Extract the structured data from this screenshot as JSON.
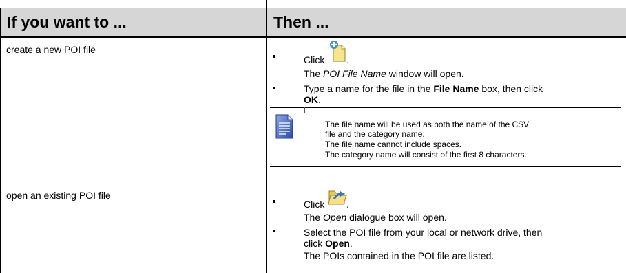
{
  "header": {
    "col1": "If you want to ...",
    "col2": "Then ..."
  },
  "rows": [
    {
      "action": "create a new POI file",
      "step1": {
        "click": "Click",
        "icon": "new-file-icon",
        "period": ".",
        "result_pre": "The ",
        "result_em": "POI File Name",
        "result_post": " window will open."
      },
      "step2": {
        "pre": "Type a name for the file in the ",
        "bold1": "File Name",
        "mid": " box, then click",
        "bold2": "OK",
        "post": "."
      },
      "note": {
        "icon": "document-note-icon",
        "lines": [
          "The file name will be used as both the name of the CSV",
          "file and the category name.",
          "The file name cannot include spaces.",
          "The category name will consist of the first 8 characters."
        ]
      }
    },
    {
      "action": "open an existing POI file",
      "step1": {
        "click": "Click",
        "icon": "open-folder-icon",
        "period": ".",
        "result_pre": "The ",
        "result_em": "Open",
        "result_post": " dialogue box will open."
      },
      "step2": {
        "pre": "Select the POI file from your local or network drive, then",
        "pre2": "click ",
        "bold": "Open",
        "post": ".",
        "result": "The POIs contained in the POI file are listed."
      }
    }
  ]
}
